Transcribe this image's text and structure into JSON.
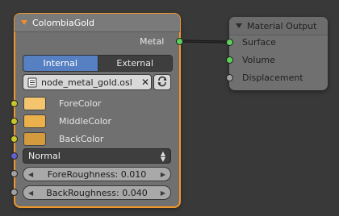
{
  "node_colombia": {
    "title": "ColombiaGold",
    "output_label": "Metal",
    "tabs": [
      {
        "label": "Internal",
        "active": true
      },
      {
        "label": "External",
        "active": false
      }
    ],
    "script_file": "node_metal_gold.osl",
    "inputs": [
      {
        "label": "ForeColor",
        "color": "#f4c56e"
      },
      {
        "label": "MiddleColor",
        "color": "#e9b04c"
      },
      {
        "label": "BackColor",
        "color": "#d49a3e"
      }
    ],
    "distribution": "Normal",
    "fore_roughness": "ForeRoughness: 0.010",
    "back_roughness": "BackRoughness: 0.040"
  },
  "node_output": {
    "title": "Material Output",
    "inputs": [
      "Surface",
      "Volume",
      "Displacement"
    ]
  },
  "colors": {
    "accent_selected": "#f0962a",
    "shader_socket": "#5bd15b",
    "color_socket": "#c7c729",
    "vector_socket": "#6060d0",
    "value_socket": "#a1a1a1",
    "tab_active": "#5680c2"
  }
}
